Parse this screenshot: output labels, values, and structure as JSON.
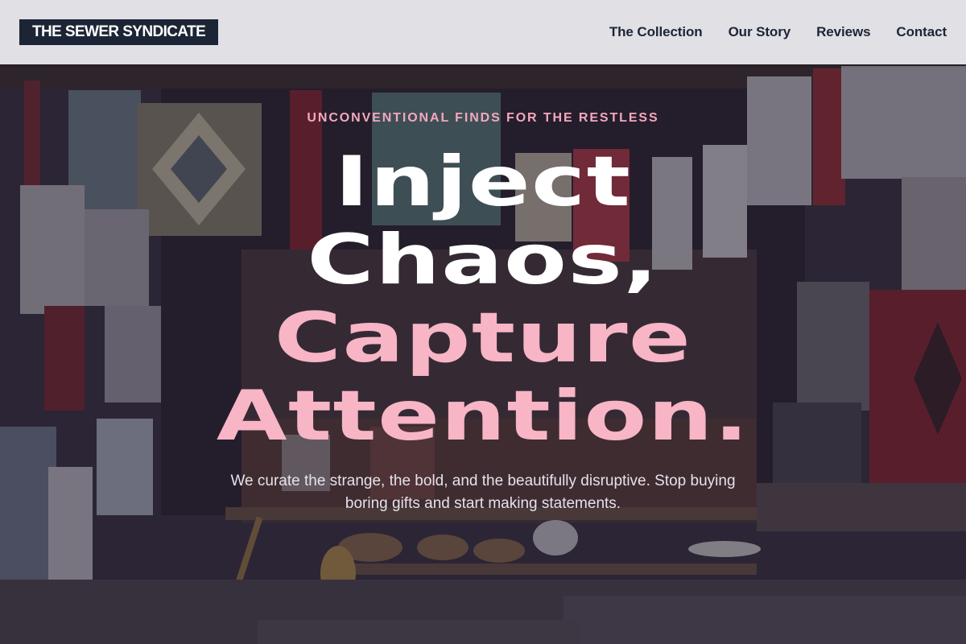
{
  "header": {
    "logo": "THE SEWER SYNDICATE",
    "nav": [
      {
        "label": "The Collection"
      },
      {
        "label": "Our Story"
      },
      {
        "label": "Reviews"
      },
      {
        "label": "Contact"
      }
    ]
  },
  "hero": {
    "eyebrow": "UNCONVENTIONAL FINDS FOR THE RESTLESS",
    "headline": [
      {
        "text": "Inject"
      },
      {
        "text": "Chaos,"
      },
      {
        "text": "Capture"
      },
      {
        "text": "Attention."
      }
    ],
    "subtitle": "We curate the strange, the bold, and the beautifully disruptive. Stop buying boring gifts and start making statements."
  },
  "colors": {
    "accent_pink": "#f7b5c6",
    "navy": "#1c2536",
    "header_bg": "#e8e8ec",
    "headline_white": "#ffffff"
  }
}
